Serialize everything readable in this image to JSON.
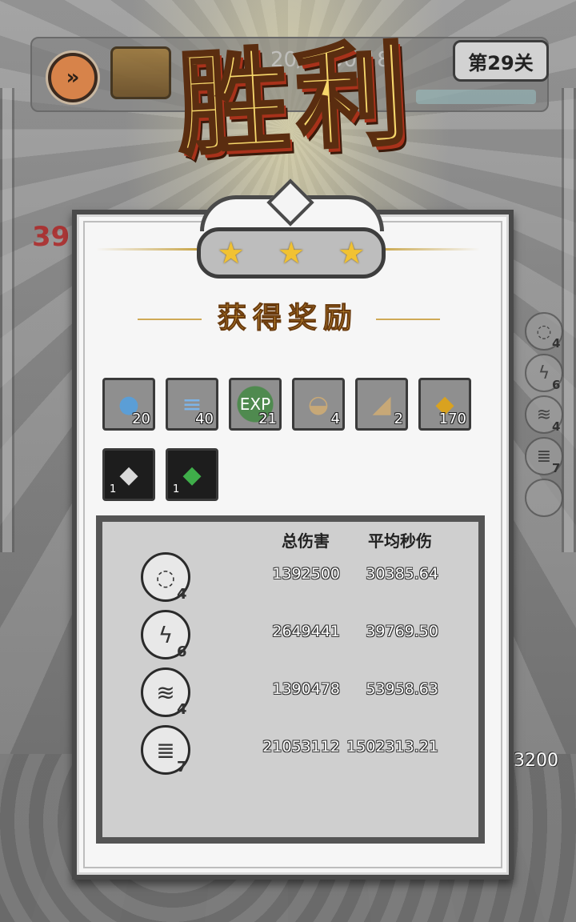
{
  "hud": {
    "fast_forward_icon": "fast-forward-icon",
    "wave_text": "20/",
    "timer_text": "00:18",
    "level_label": "第29关"
  },
  "victory_title": "胜利",
  "stars": [
    "★",
    "★",
    "★"
  ],
  "rewards_title": "获得奖励",
  "rewards": [
    {
      "icon": "blue-gem-bomb-icon",
      "glyph": "●",
      "count": "20",
      "color": "#5b9ed6"
    },
    {
      "icon": "blue-gem-ice-icon",
      "glyph": "≡",
      "count": "40",
      "color": "#7cb4e8"
    },
    {
      "icon": "exp-orb-icon",
      "glyph": "EXP",
      "count": "21",
      "color": "#4f8a4f"
    },
    {
      "icon": "hat-scroll-icon",
      "glyph": "◒",
      "count": "4",
      "color": "#c7a877"
    },
    {
      "icon": "boot-scroll-icon",
      "glyph": "◢",
      "count": "2",
      "color": "#c7a877"
    },
    {
      "icon": "gold-coin-icon",
      "glyph": "◆",
      "count": "170",
      "color": "#d9a21f"
    },
    {
      "icon": "stone-icon",
      "glyph": "◆",
      "count": "1",
      "color": "#2e2e2e"
    },
    {
      "icon": "green-crystal-icon",
      "glyph": "◆",
      "count": "1",
      "color": "#2f6b35"
    }
  ],
  "stats": {
    "col_total": "总伤害",
    "col_dps": "平均秒伤",
    "rows": [
      {
        "icon": "water-drop-skill-icon",
        "glyph": "◌",
        "level": "4",
        "total": "1392500",
        "dps": "30385.64"
      },
      {
        "icon": "lightning-skill-icon",
        "glyph": "ϟ",
        "level": "6",
        "total": "2649441",
        "dps": "39769.50"
      },
      {
        "icon": "thunder-chain-skill-icon",
        "glyph": "≋",
        "level": "4",
        "total": "1390478",
        "dps": "53958.63"
      },
      {
        "icon": "tornado-skill-icon",
        "glyph": "≣",
        "level": "7",
        "total": "21053112",
        "dps": "1502313.21"
      }
    ]
  },
  "side_skills": [
    {
      "icon": "water-drop-skill-icon",
      "level": "4"
    },
    {
      "icon": "lightning-skill-icon",
      "level": "6"
    },
    {
      "icon": "thunder-chain-skill-icon",
      "level": "4"
    },
    {
      "icon": "tornado-skill-icon",
      "level": "7"
    },
    {
      "icon": "empty-skill-slot-icon",
      "level": ""
    }
  ],
  "background": {
    "red_number": "39",
    "hp_number": "3200"
  }
}
